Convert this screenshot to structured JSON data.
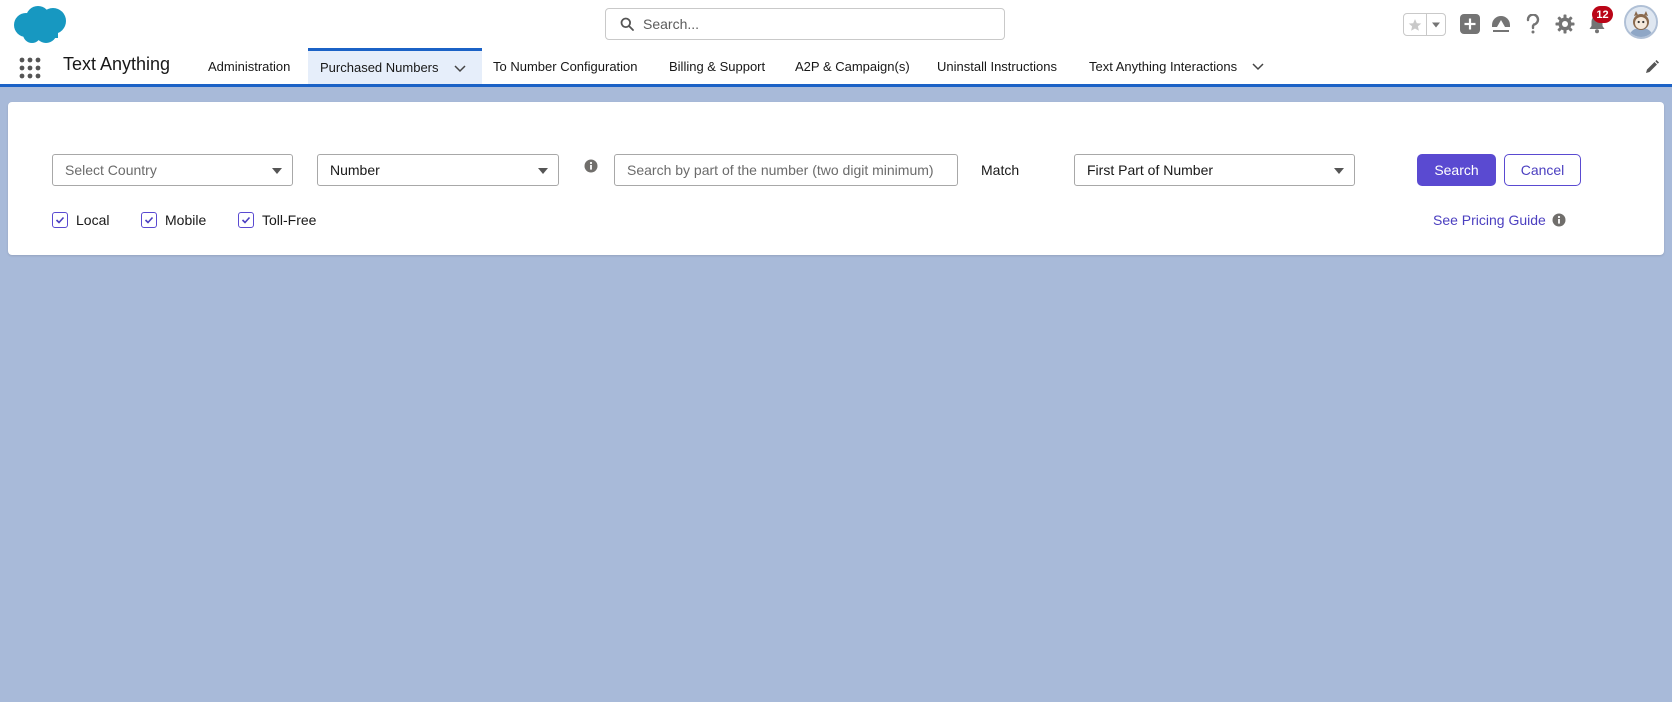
{
  "header": {
    "search_placeholder": "Search...",
    "notification_count": "12",
    "icons": [
      "salesforce-cloud-logo",
      "search-icon",
      "star-icon",
      "chevron-down-icon",
      "add-icon",
      "trailhead-icon",
      "help-icon",
      "gear-icon",
      "bell-icon",
      "avatar"
    ]
  },
  "nav": {
    "app_name": "Text Anything",
    "items": [
      {
        "label": "Administration"
      },
      {
        "label": "Purchased Numbers",
        "active": true,
        "has_dropdown": true
      },
      {
        "label": "To Number Configuration"
      },
      {
        "label": "Billing & Support"
      },
      {
        "label": "A2P & Campaign(s)"
      },
      {
        "label": "Uninstall Instructions"
      },
      {
        "label": "Text Anything Interactions",
        "has_dropdown": true
      }
    ]
  },
  "search_form": {
    "country_select": "Select Country",
    "type_select": "Number",
    "number_input_placeholder": "Search by part of the number (two digit minimum)",
    "match_label": "Match",
    "match_select": "First Part of Number",
    "search_button": "Search",
    "cancel_button": "Cancel",
    "checkboxes": [
      {
        "label": "Local",
        "checked": true
      },
      {
        "label": "Mobile",
        "checked": true
      },
      {
        "label": "Toll-Free",
        "checked": true
      }
    ],
    "pricing_link": "See Pricing Guide"
  },
  "colors": {
    "page_background": "#a8bad9",
    "brand_blue": "#1b62c6",
    "button_purple": "#5a4ad1",
    "badge_red": "#ba0517"
  }
}
